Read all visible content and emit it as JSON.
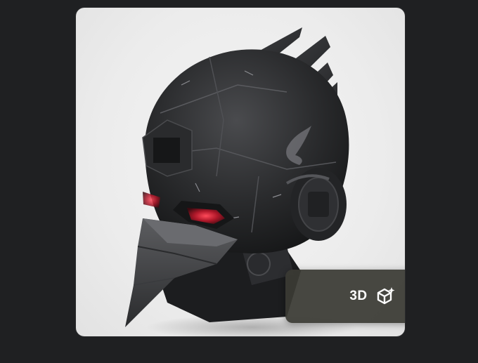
{
  "viewer": {
    "button_label": "3D",
    "button_icon": "cube-sparkle-icon",
    "image_subject": "raven-helmet",
    "colors": {
      "page_background": "#1f2022",
      "card_background": "#efefef",
      "button_background": "#3a3a34",
      "button_text": "#ffffff",
      "eye_glow": "#c0182a"
    }
  }
}
